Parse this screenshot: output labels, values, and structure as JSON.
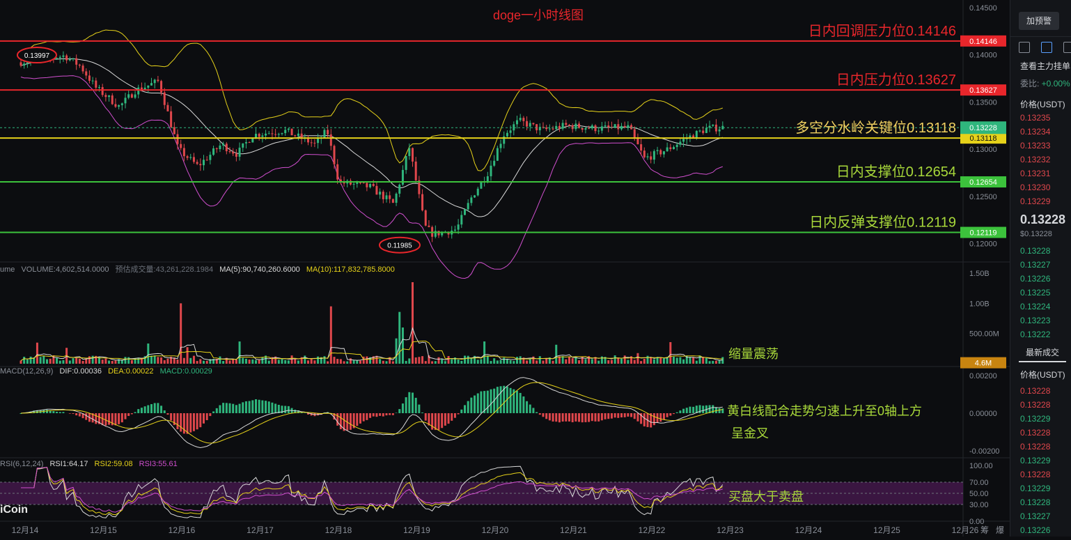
{
  "title": "doge一小时线图",
  "price_axis": {
    "ticks": [
      "0.14500",
      "0.14000",
      "0.13500",
      "0.13000",
      "0.12500",
      "0.12000"
    ]
  },
  "volume_axis": {
    "ticks": [
      "1.50B",
      "1.00B",
      "500.00M"
    ]
  },
  "macd_axis": {
    "ticks": [
      "0.00200",
      "0.00000",
      "-0.00200"
    ]
  },
  "rsi_axis": {
    "ticks": [
      "100.00",
      "70.00",
      "50.00",
      "30.00",
      "0.00"
    ]
  },
  "x_axis": {
    "labels": [
      "12月14",
      "12月15",
      "12月16",
      "12月17",
      "12月18",
      "12月19",
      "12月20",
      "12月21",
      "12月22",
      "12月23",
      "12月24",
      "12月25",
      "12月26"
    ]
  },
  "levels": [
    {
      "text": "日内回调压力位0.14146",
      "tag": "0.14146",
      "value": 0.14146,
      "color": "#e8262b",
      "text_color": "#e8262b"
    },
    {
      "text": "日内压力位0.13627",
      "tag": "0.13627",
      "value": 0.13627,
      "color": "#e8262b",
      "text_color": "#e8262b"
    },
    {
      "text": "多空分水岭关键位0.13118",
      "tag": "0.13118",
      "value": 0.13118,
      "color": "#e6d21a",
      "text_color": "#f0d060"
    },
    {
      "text": "日内支撑位0.12654",
      "tag": "0.12654",
      "value": 0.12654,
      "color": "#3cc23c",
      "text_color": "#a8d83a"
    },
    {
      "text": "日内反弹支撑位0.12119",
      "tag": "0.12119",
      "value": 0.12119,
      "color": "#3cc23c",
      "text_color": "#a8d83a"
    }
  ],
  "current_price_tag": "0.13228",
  "marker_high": "0.13997",
  "marker_low": "0.11985",
  "volume_info": {
    "label": "ume",
    "volume": "VOLUME:4,602,514.0000",
    "est": "预估成交量:43,261,228.1984",
    "ma5": "MA(5):90,740,260.6000",
    "ma10": "MA(10):117,832,785.8000"
  },
  "volume_tag": "4.6M",
  "volume_note": "缩量震荡",
  "macd_info": {
    "label": "MACD(12,26,9)",
    "dif": "DIF:0.00036",
    "dea": "DEA:0.00022",
    "macd": "MACD:0.00029"
  },
  "macd_note_1": "黄白线配合走势匀速上升至0轴上方",
  "macd_note_2": "呈金叉",
  "rsi_info": {
    "label": "RSI(6,12,24)",
    "rsi1": "RSI1:64.17",
    "rsi2": "RSI2:59.08",
    "rsi3": "RSI3:55.61"
  },
  "rsi_note": "买盘大于卖盘",
  "watermark": "iCoin",
  "corner_labels": {
    "left": "筹",
    "right": "爆"
  },
  "colors": {
    "up": "#2fb67d",
    "down": "#e0474c",
    "ma_white": "#d9d9d9",
    "ma_yellow": "#e6d21a",
    "boll_lower": "#d14fcf"
  },
  "chart_data": {
    "type": "candlestick",
    "title": "doge一小时线图",
    "x_range": [
      "12月14",
      "12月26"
    ],
    "price_range": [
      0.1185,
      0.1458
    ],
    "price_path": [
      {
        "x": 0.0,
        "y": 0.1392
      },
      {
        "x": 0.6,
        "y": 0.1399
      },
      {
        "x": 0.8,
        "y": 0.1388
      },
      {
        "x": 1.0,
        "y": 0.1365
      },
      {
        "x": 1.3,
        "y": 0.1345
      },
      {
        "x": 1.5,
        "y": 0.1362
      },
      {
        "x": 1.8,
        "y": 0.1372
      },
      {
        "x": 2.05,
        "y": 0.13
      },
      {
        "x": 2.3,
        "y": 0.1282
      },
      {
        "x": 2.6,
        "y": 0.1305
      },
      {
        "x": 2.8,
        "y": 0.1295
      },
      {
        "x": 3.0,
        "y": 0.1315
      },
      {
        "x": 3.4,
        "y": 0.132
      },
      {
        "x": 3.8,
        "y": 0.1305
      },
      {
        "x": 3.95,
        "y": 0.132
      },
      {
        "x": 4.1,
        "y": 0.1265
      },
      {
        "x": 4.5,
        "y": 0.126
      },
      {
        "x": 4.8,
        "y": 0.1242
      },
      {
        "x": 5.0,
        "y": 0.1302
      },
      {
        "x": 5.2,
        "y": 0.1218
      },
      {
        "x": 5.3,
        "y": 0.121
      },
      {
        "x": 5.6,
        "y": 0.1215
      },
      {
        "x": 5.8,
        "y": 0.125
      },
      {
        "x": 6.0,
        "y": 0.1275
      },
      {
        "x": 6.2,
        "y": 0.1315
      },
      {
        "x": 6.4,
        "y": 0.133
      },
      {
        "x": 6.7,
        "y": 0.132
      },
      {
        "x": 7.0,
        "y": 0.1325
      },
      {
        "x": 7.4,
        "y": 0.1322
      },
      {
        "x": 7.8,
        "y": 0.1323
      },
      {
        "x": 8.0,
        "y": 0.129
      },
      {
        "x": 8.3,
        "y": 0.13
      },
      {
        "x": 8.5,
        "y": 0.131
      },
      {
        "x": 8.8,
        "y": 0.1322
      },
      {
        "x": 9.0,
        "y": 0.1323
      }
    ],
    "levels": [
      0.14146,
      0.13627,
      0.13118,
      0.12654,
      0.12119
    ],
    "last_price": 0.13228,
    "high_marker": 0.13997,
    "low_marker": 0.11985,
    "volume_spikes": [
      {
        "x": 2.05,
        "y": 1.0
      },
      {
        "x": 3.95,
        "y": 0.95
      },
      {
        "x": 5.0,
        "y": 1.35
      },
      {
        "x": 4.85,
        "y": 0.6
      }
    ],
    "volume_range": [
      0,
      1.5
    ],
    "macd_range": [
      -0.0025,
      0.0025
    ],
    "rsi_range": [
      0,
      100
    ],
    "rsi_bands": [
      30,
      50,
      70
    ]
  }
}
